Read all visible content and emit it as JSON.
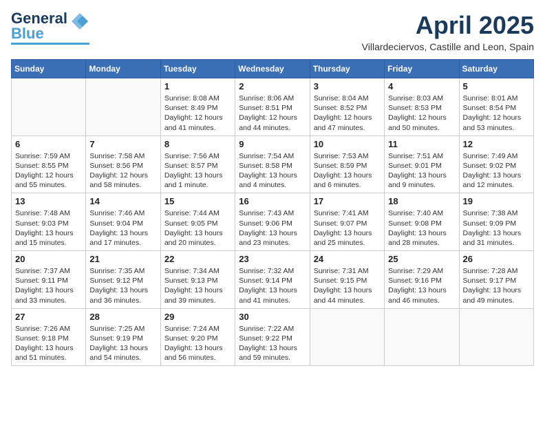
{
  "header": {
    "logo_general": "General",
    "logo_blue": "Blue",
    "month_title": "April 2025",
    "location": "Villardeciervos, Castille and Leon, Spain"
  },
  "weekdays": [
    "Sunday",
    "Monday",
    "Tuesday",
    "Wednesday",
    "Thursday",
    "Friday",
    "Saturday"
  ],
  "weeks": [
    [
      {
        "day": "",
        "info": ""
      },
      {
        "day": "",
        "info": ""
      },
      {
        "day": "1",
        "info": "Sunrise: 8:08 AM\nSunset: 8:49 PM\nDaylight: 12 hours and 41 minutes."
      },
      {
        "day": "2",
        "info": "Sunrise: 8:06 AM\nSunset: 8:51 PM\nDaylight: 12 hours and 44 minutes."
      },
      {
        "day": "3",
        "info": "Sunrise: 8:04 AM\nSunset: 8:52 PM\nDaylight: 12 hours and 47 minutes."
      },
      {
        "day": "4",
        "info": "Sunrise: 8:03 AM\nSunset: 8:53 PM\nDaylight: 12 hours and 50 minutes."
      },
      {
        "day": "5",
        "info": "Sunrise: 8:01 AM\nSunset: 8:54 PM\nDaylight: 12 hours and 53 minutes."
      }
    ],
    [
      {
        "day": "6",
        "info": "Sunrise: 7:59 AM\nSunset: 8:55 PM\nDaylight: 12 hours and 55 minutes."
      },
      {
        "day": "7",
        "info": "Sunrise: 7:58 AM\nSunset: 8:56 PM\nDaylight: 12 hours and 58 minutes."
      },
      {
        "day": "8",
        "info": "Sunrise: 7:56 AM\nSunset: 8:57 PM\nDaylight: 13 hours and 1 minute."
      },
      {
        "day": "9",
        "info": "Sunrise: 7:54 AM\nSunset: 8:58 PM\nDaylight: 13 hours and 4 minutes."
      },
      {
        "day": "10",
        "info": "Sunrise: 7:53 AM\nSunset: 8:59 PM\nDaylight: 13 hours and 6 minutes."
      },
      {
        "day": "11",
        "info": "Sunrise: 7:51 AM\nSunset: 9:01 PM\nDaylight: 13 hours and 9 minutes."
      },
      {
        "day": "12",
        "info": "Sunrise: 7:49 AM\nSunset: 9:02 PM\nDaylight: 13 hours and 12 minutes."
      }
    ],
    [
      {
        "day": "13",
        "info": "Sunrise: 7:48 AM\nSunset: 9:03 PM\nDaylight: 13 hours and 15 minutes."
      },
      {
        "day": "14",
        "info": "Sunrise: 7:46 AM\nSunset: 9:04 PM\nDaylight: 13 hours and 17 minutes."
      },
      {
        "day": "15",
        "info": "Sunrise: 7:44 AM\nSunset: 9:05 PM\nDaylight: 13 hours and 20 minutes."
      },
      {
        "day": "16",
        "info": "Sunrise: 7:43 AM\nSunset: 9:06 PM\nDaylight: 13 hours and 23 minutes."
      },
      {
        "day": "17",
        "info": "Sunrise: 7:41 AM\nSunset: 9:07 PM\nDaylight: 13 hours and 25 minutes."
      },
      {
        "day": "18",
        "info": "Sunrise: 7:40 AM\nSunset: 9:08 PM\nDaylight: 13 hours and 28 minutes."
      },
      {
        "day": "19",
        "info": "Sunrise: 7:38 AM\nSunset: 9:09 PM\nDaylight: 13 hours and 31 minutes."
      }
    ],
    [
      {
        "day": "20",
        "info": "Sunrise: 7:37 AM\nSunset: 9:11 PM\nDaylight: 13 hours and 33 minutes."
      },
      {
        "day": "21",
        "info": "Sunrise: 7:35 AM\nSunset: 9:12 PM\nDaylight: 13 hours and 36 minutes."
      },
      {
        "day": "22",
        "info": "Sunrise: 7:34 AM\nSunset: 9:13 PM\nDaylight: 13 hours and 39 minutes."
      },
      {
        "day": "23",
        "info": "Sunrise: 7:32 AM\nSunset: 9:14 PM\nDaylight: 13 hours and 41 minutes."
      },
      {
        "day": "24",
        "info": "Sunrise: 7:31 AM\nSunset: 9:15 PM\nDaylight: 13 hours and 44 minutes."
      },
      {
        "day": "25",
        "info": "Sunrise: 7:29 AM\nSunset: 9:16 PM\nDaylight: 13 hours and 46 minutes."
      },
      {
        "day": "26",
        "info": "Sunrise: 7:28 AM\nSunset: 9:17 PM\nDaylight: 13 hours and 49 minutes."
      }
    ],
    [
      {
        "day": "27",
        "info": "Sunrise: 7:26 AM\nSunset: 9:18 PM\nDaylight: 13 hours and 51 minutes."
      },
      {
        "day": "28",
        "info": "Sunrise: 7:25 AM\nSunset: 9:19 PM\nDaylight: 13 hours and 54 minutes."
      },
      {
        "day": "29",
        "info": "Sunrise: 7:24 AM\nSunset: 9:20 PM\nDaylight: 13 hours and 56 minutes."
      },
      {
        "day": "30",
        "info": "Sunrise: 7:22 AM\nSunset: 9:22 PM\nDaylight: 13 hours and 59 minutes."
      },
      {
        "day": "",
        "info": ""
      },
      {
        "day": "",
        "info": ""
      },
      {
        "day": "",
        "info": ""
      }
    ]
  ]
}
